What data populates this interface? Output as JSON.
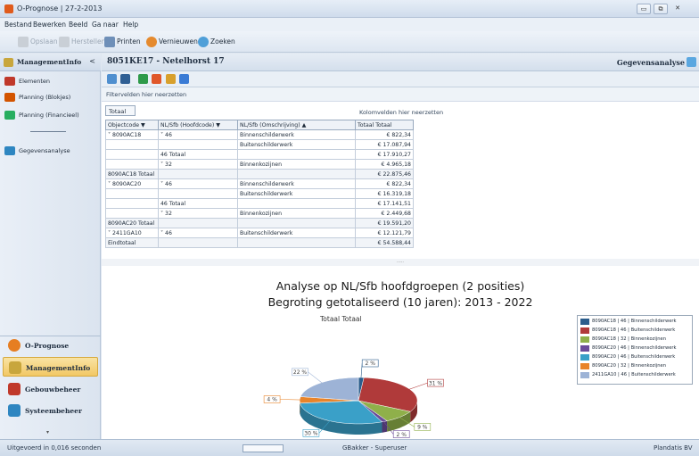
{
  "window": {
    "title": "O-Prognose | 27-2-2013",
    "minimize": "▭",
    "maximize": "⧉",
    "close": "✕"
  },
  "menu": [
    "Bestand",
    "Bewerken",
    "Beeld",
    "Ga naar",
    "Help"
  ],
  "toolbar": {
    "save": "Opslaan",
    "restore": "Herstellen",
    "print": "Printen",
    "refresh": "Vernieuwen",
    "search": "Zoeken"
  },
  "sidebar": {
    "header": "ManagementInfo",
    "header_chevron": "<",
    "items": [
      {
        "label": "Elementen",
        "icon": "elements-icon",
        "color": "#c0392b"
      },
      {
        "label": "Planning (Blokjes)",
        "icon": "planning-blocks-icon",
        "color": "#d35400"
      },
      {
        "label": "Planning (Financieel)",
        "icon": "planning-financial-icon",
        "color": "#27ae60"
      },
      {
        "label": "Gegevensanalyse",
        "icon": "data-analysis-icon",
        "color": "#2e86c1"
      }
    ],
    "nav": [
      {
        "label": "O-Prognose",
        "icon": "gear-icon",
        "color": "#e67e22"
      },
      {
        "label": "ManagementInfo",
        "icon": "management-icon",
        "color": "#c8a63c"
      },
      {
        "label": "Gebouwbeheer",
        "icon": "building-icon",
        "color": "#c0392b"
      },
      {
        "label": "Systeembeheer",
        "icon": "system-icon",
        "color": "#2e86c1"
      }
    ],
    "handle": "▾"
  },
  "content": {
    "object": "8051KE17 - Netelhorst 17",
    "mode": "Gegevensanalyse"
  },
  "pivot": {
    "filter_hint": "Filtervelden hier neerzetten",
    "data_field": "Totaal",
    "column_hint": "Kolomvelden hier neerzetten",
    "headers": [
      "Objectcode ▼",
      "NL/Sfb (Hoofdcode) ▼",
      "NL/Sfb (Omschrijving) ▲",
      "Totaal Totaal"
    ],
    "rows": [
      {
        "c1": "˅ 8090AC18",
        "c2": "˅ 46",
        "c3": "Binnenschilderwerk",
        "val": "€ 822,34"
      },
      {
        "c1": "",
        "c2": "",
        "c3": "Buitenschilderwerk",
        "val": "€ 17.087,94"
      },
      {
        "c1": "",
        "c2": "46 Totaal",
        "c3": "",
        "val": "€ 17.910,27"
      },
      {
        "c1": "",
        "c2": "˅ 32",
        "c3": "Binnenkozijnen",
        "val": "€ 4.965,18"
      },
      {
        "c1": "8090AC18 Totaal",
        "c2": "",
        "c3": "",
        "val": "€ 22.875,46",
        "total": true
      },
      {
        "c1": "˅ 8090AC20",
        "c2": "˅ 46",
        "c3": "Binnenschilderwerk",
        "val": "€ 822,34"
      },
      {
        "c1": "",
        "c2": "",
        "c3": "Buitenschilderwerk",
        "val": "€ 16.319,18"
      },
      {
        "c1": "",
        "c2": "46 Totaal",
        "c3": "",
        "val": "€ 17.141,51"
      },
      {
        "c1": "",
        "c2": "˅ 32",
        "c3": "Binnenkozijnen",
        "val": "€ 2.449,68"
      },
      {
        "c1": "8090AC20 Totaal",
        "c2": "",
        "c3": "",
        "val": "€ 19.591,20",
        "total": true
      },
      {
        "c1": "˅ 2411GA10",
        "c2": "˅ 46",
        "c3": "Buitenschilderwerk",
        "val": "€ 12.121,79"
      },
      {
        "c1": "Eindtotaal",
        "c2": "",
        "c3": "",
        "val": "€ 54.588,44",
        "total": true
      }
    ],
    "splitter": "....."
  },
  "chart_data": {
    "type": "pie",
    "title": "Analyse op NL/Sfb hoofdgroepen (2 posities)",
    "subtitle": "Begroting getotaliseerd (10 jaren): 2013 - 2022",
    "series_title": "Totaal Totaal",
    "legend_position": "right",
    "slices": [
      {
        "name": "8090AC18 | 46 | Binnenschilderwerk",
        "value": 822.34,
        "color": "#2b5d8c",
        "label": "2 %"
      },
      {
        "name": "8090AC18 | 46 | Buitenschilderwerk",
        "value": 17087.94,
        "color": "#b03a3a",
        "label": "31 %"
      },
      {
        "name": "8090AC18 | 32 | Binnenkozijnen",
        "value": 4965.18,
        "color": "#8fb04a",
        "label": "9 %"
      },
      {
        "name": "8090AC20 | 46 | Binnenschilderwerk",
        "value": 822.34,
        "color": "#6b4c9a",
        "label": "2 %"
      },
      {
        "name": "8090AC20 | 46 | Buitenschilderwerk",
        "value": 16319.18,
        "color": "#3aa0c8",
        "label": "30 %"
      },
      {
        "name": "8090AC20 | 32 | Binnenkozijnen",
        "value": 2449.68,
        "color": "#e8842a",
        "label": "4 %"
      },
      {
        "name": "2411GA10 | 46 | Buitenschilderwerk",
        "value": 12121.79,
        "color": "#9db3d6",
        "label": "22 %"
      }
    ]
  },
  "status": {
    "time": "Uitgevoerd in 0,016 seconden",
    "user": "GBakker - Superuser",
    "company": "Plandatis BV"
  }
}
